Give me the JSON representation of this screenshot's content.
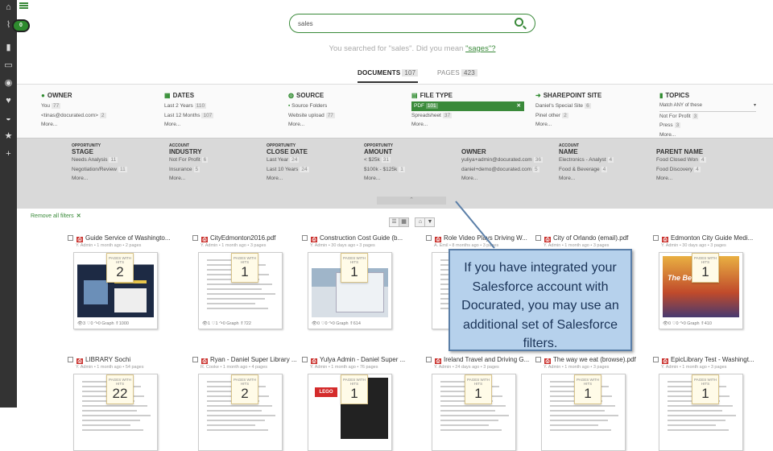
{
  "search": {
    "value": "sales"
  },
  "did_you_mean": {
    "prefix": "You searched for \"sales\". Did you mean",
    "suggestion": "\"sages\"?"
  },
  "tabs": [
    {
      "label": "DOCUMENTS",
      "count": "107"
    },
    {
      "label": "PAGES",
      "count": "423"
    }
  ],
  "facets": [
    {
      "title": "OWNER",
      "icon": "user-icon",
      "items": [
        {
          "label": "You",
          "count": "77"
        },
        {
          "label": "<tinas@docurated.com>",
          "count": "2"
        }
      ],
      "more": "More..."
    },
    {
      "title": "DATES",
      "icon": "calendar-icon",
      "items": [
        {
          "label": "Last 2 Years",
          "count": "110"
        },
        {
          "label": "Last 12 Months",
          "count": "107"
        }
      ],
      "more": "More..."
    },
    {
      "title": "SOURCE",
      "icon": "globe-icon",
      "items": [
        {
          "label": "Source Folders",
          "count": ""
        },
        {
          "label": "Website upload",
          "count": "77"
        }
      ],
      "more": "More..."
    },
    {
      "title": "FILE TYPE",
      "icon": "file-icon",
      "selected": {
        "label": "PDF",
        "count": "101"
      },
      "items": [
        {
          "label": "Spreadsheet",
          "count": "37"
        }
      ],
      "more": "More..."
    },
    {
      "title": "SHAREPOINT SITE",
      "icon": "share-arrow-icon",
      "items": [
        {
          "label": "Daniel's Special Site",
          "count": "6"
        },
        {
          "label": "Pinel other",
          "count": "2"
        }
      ],
      "more": "More..."
    },
    {
      "title": "TOPICS",
      "icon": "bookmark-icon",
      "dropdown": "Match ANY of these",
      "items": [
        {
          "label": "Not For Profit",
          "count": "3"
        },
        {
          "label": "Press",
          "count": "3"
        }
      ],
      "more": "More..."
    }
  ],
  "sf_facets": [
    {
      "sub": "OPPORTUNITY",
      "title": "STAGE",
      "items": [
        {
          "label": "Needs Analysis",
          "count": "11"
        },
        {
          "label": "Negotiation/Review",
          "count": "11"
        }
      ],
      "more": "More..."
    },
    {
      "sub": "ACCOUNT",
      "title": "INDUSTRY",
      "items": [
        {
          "label": "Not For Profit",
          "count": "6"
        },
        {
          "label": "Insurance",
          "count": "5"
        }
      ],
      "more": "More..."
    },
    {
      "sub": "OPPORTUNITY",
      "title": "CLOSE DATE",
      "items": [
        {
          "label": "Last Year",
          "count": "24"
        },
        {
          "label": "Last 10 Years",
          "count": "24"
        }
      ],
      "more": "More..."
    },
    {
      "sub": "OPPORTUNITY",
      "title": "AMOUNT",
      "items": [
        {
          "label": "< $25k",
          "count": "31"
        },
        {
          "label": "$100k - $125k",
          "count": "1"
        }
      ],
      "more": "More..."
    },
    {
      "sub": "",
      "title": "OWNER",
      "items": [
        {
          "label": "yuliya+admin@docurated.com",
          "count": "36"
        },
        {
          "label": "daniel+demo@docurated.com",
          "count": "5"
        }
      ],
      "more": "More..."
    },
    {
      "sub": "ACCOUNT",
      "title": "NAME",
      "items": [
        {
          "label": "Electronics - Analyst",
          "count": "4"
        },
        {
          "label": "Food & Beverage",
          "count": "4"
        }
      ],
      "more": "More..."
    },
    {
      "sub": "",
      "title": "PARENT NAME",
      "items": [
        {
          "label": "Food Closed Won",
          "count": "4"
        },
        {
          "label": "Food Discovery",
          "count": "4"
        }
      ],
      "more": "More..."
    }
  ],
  "remove_all": "Remove all filters",
  "pages_with_hits_label": "PAGES WITH HITS",
  "cards_row1": [
    {
      "title": "Guide Service of Washingto...",
      "meta": "Y. Admin • 1 month ago • 2 pages",
      "hits": "2",
      "foot": "👁3  ♡0  ↷0  Graph  ⇑1000",
      "theme": "dark"
    },
    {
      "title": "CityEdmonton2016.pdf",
      "meta": "Y. Admin • 1 month ago • 3 pages",
      "hits": "1",
      "foot": "👁1  ♡1  ↷0  Graph  ⇑722",
      "theme": "doc"
    },
    {
      "title": "Construction Cost Guide (b...",
      "meta": "Y. Admin • 30 days ago • 3 pages",
      "hits": "1",
      "foot": "👁0  ♡0  ↷0  Graph  ⇑614",
      "theme": "build"
    },
    {
      "title": "Role Video Plays Driving W...",
      "meta": "A. Emil • 8 months ago • 3 pages",
      "hits": "",
      "foot": "",
      "theme": "doc"
    },
    {
      "title": "City of Orlando (email).pdf",
      "meta": "Y. Admin • 1 month ago • 3 pages",
      "hits": "",
      "foot": "",
      "theme": "doc"
    },
    {
      "title": "Edmonton City Guide Medi...",
      "meta": "Y. Admin • 30 days ago • 3 pages",
      "hits": "1",
      "foot": "👁0  ♡0  ↷0  Graph  ⇑410",
      "theme": "city"
    }
  ],
  "cards_row2": [
    {
      "title": "LIBRARY Sochi",
      "meta": "Y. Admin • 1 month ago • 54 pages",
      "hits": "22",
      "theme": "doc"
    },
    {
      "title": "Ryan - Daniel Super Library ...",
      "meta": "R. Cooke • 1 month ago • 4 pages",
      "hits": "2",
      "theme": "doc"
    },
    {
      "title": "Yulya Admin - Daniel Super ...",
      "meta": "Y. Admin • 1 month ago • 76 pages",
      "hits": "1",
      "theme": "lego"
    },
    {
      "title": "Ireland Travel and Driving G...",
      "meta": "Y. Admin • 24 days ago • 3 pages",
      "hits": "1",
      "theme": "doc"
    },
    {
      "title": "The way we eat (browse).pdf",
      "meta": "Y. Admin • 1 month ago • 3 pages",
      "hits": "1",
      "theme": "doc"
    },
    {
      "title": "EpicLibrary Test - Washingt...",
      "meta": "Y. Admin • 1 month ago • 3 pages",
      "hits": "1",
      "theme": "doc"
    }
  ],
  "callout": "If you have integrated your Salesforce account with Docurated, you may use an additional set of Salesforce filters.",
  "colors": {
    "accent": "#3a8a3a",
    "pdf": "#c9302c",
    "callout_bg": "#b6d1ec"
  }
}
